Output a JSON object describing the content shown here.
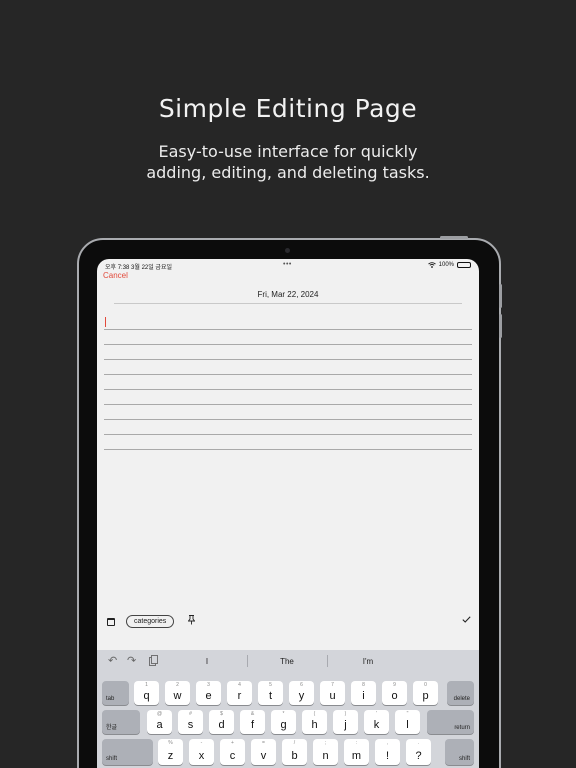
{
  "promo": {
    "title": "Simple Editing Page",
    "subtitle_line1": "Easy-to-use interface for quickly",
    "subtitle_line2": "adding, editing, and deleting tasks."
  },
  "status_bar": {
    "left": "오후 7:38   3월 22일 금요일",
    "dots": "•••",
    "battery": "100%"
  },
  "editor": {
    "cancel_label": "Cancel",
    "date": "Fri, Mar 22, 2024",
    "accent_color": "#e24a3b"
  },
  "toolbar": {
    "categories_label": "categories",
    "calendar_icon": "calendar-icon",
    "pin_icon": "pin-icon",
    "check_icon": "checkmark-icon"
  },
  "keyboard": {
    "suggestions": [
      "I",
      "The",
      "I'm"
    ],
    "row1": [
      {
        "main": "q",
        "sub": "1"
      },
      {
        "main": "w",
        "sub": "2"
      },
      {
        "main": "e",
        "sub": "3"
      },
      {
        "main": "r",
        "sub": "4"
      },
      {
        "main": "t",
        "sub": "5"
      },
      {
        "main": "y",
        "sub": "6"
      },
      {
        "main": "u",
        "sub": "7"
      },
      {
        "main": "i",
        "sub": "8"
      },
      {
        "main": "o",
        "sub": "9"
      },
      {
        "main": "p",
        "sub": "0"
      }
    ],
    "row2": [
      {
        "main": "a",
        "sub": "@"
      },
      {
        "main": "s",
        "sub": "#"
      },
      {
        "main": "d",
        "sub": "$"
      },
      {
        "main": "f",
        "sub": "&"
      },
      {
        "main": "g",
        "sub": "*"
      },
      {
        "main": "h",
        "sub": "("
      },
      {
        "main": "j",
        "sub": ")"
      },
      {
        "main": "k",
        "sub": "'"
      },
      {
        "main": "l",
        "sub": "\""
      }
    ],
    "row3": [
      {
        "main": "z",
        "sub": "%"
      },
      {
        "main": "x",
        "sub": "-"
      },
      {
        "main": "c",
        "sub": "+"
      },
      {
        "main": "v",
        "sub": "="
      },
      {
        "main": "b",
        "sub": "/"
      },
      {
        "main": "n",
        "sub": ";"
      },
      {
        "main": "m",
        "sub": ":"
      },
      {
        "main": "!",
        "sub": ","
      },
      {
        "main": "?",
        "sub": "."
      }
    ],
    "tab_label": "tab",
    "delete_label": "delete",
    "lang_label": "한글",
    "return_label": "return",
    "shift_label": "shift"
  }
}
